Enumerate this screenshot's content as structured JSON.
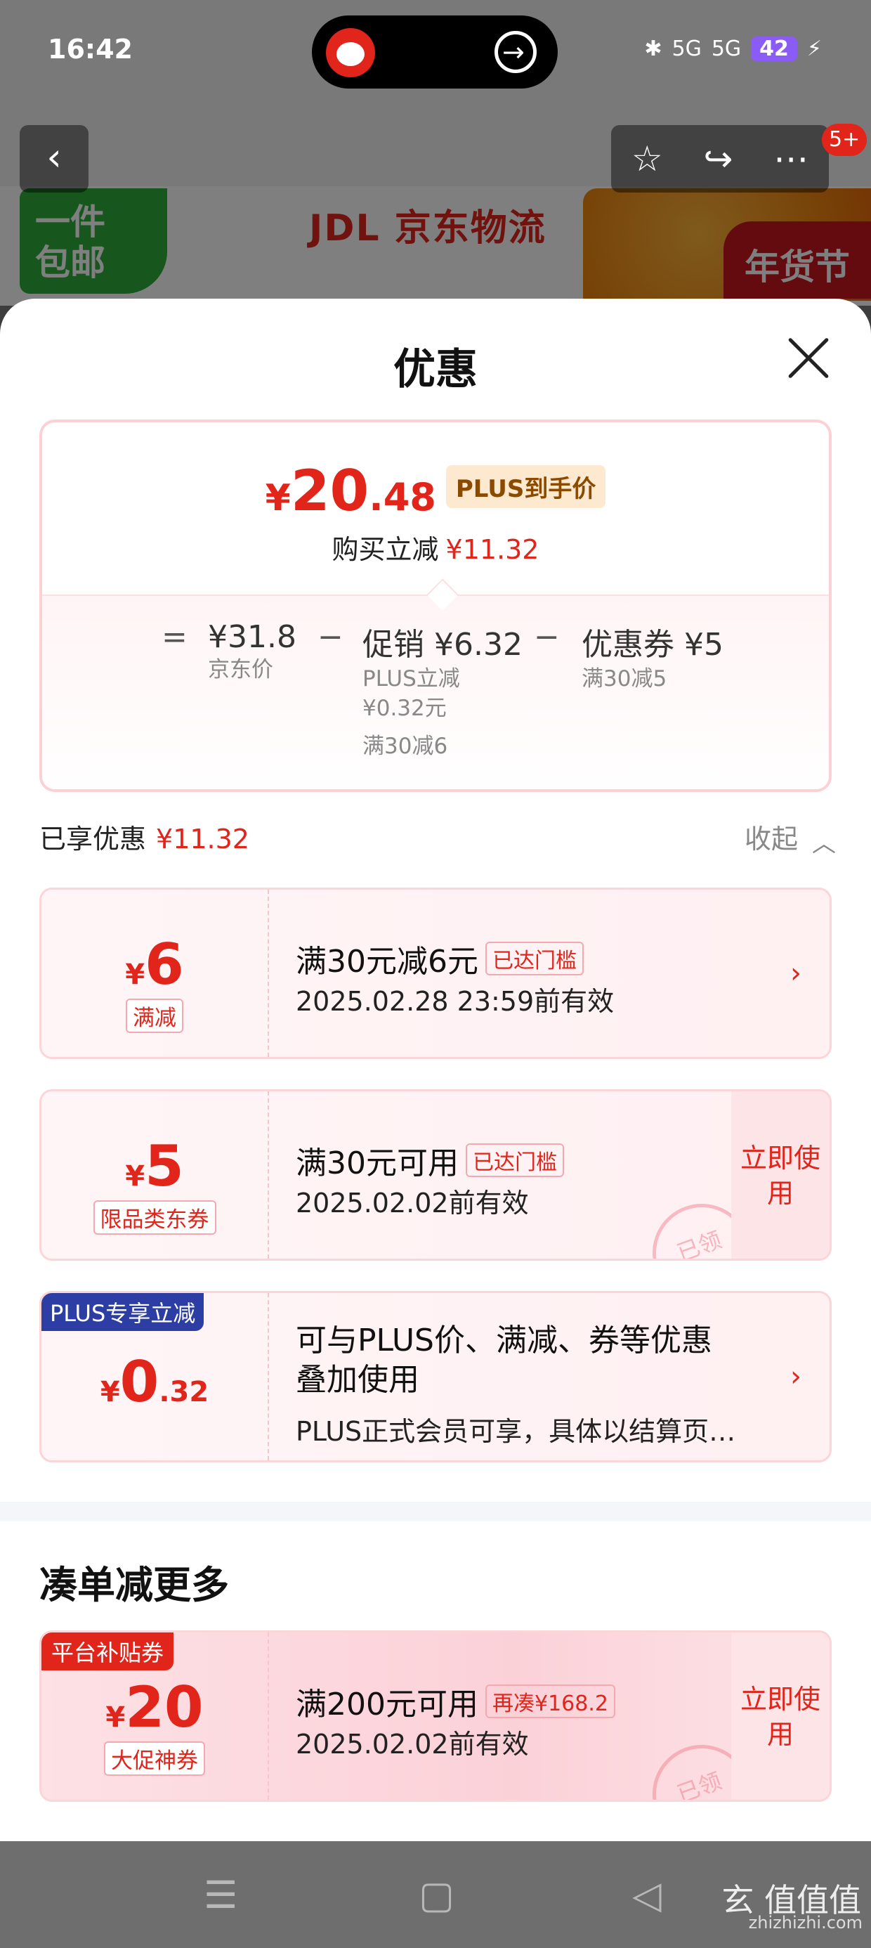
{
  "status_bar": {
    "time": "16:42",
    "signal1": "5G",
    "signal2": "5G",
    "battery": "42"
  },
  "background": {
    "banner_left_lines": [
      "一件",
      "包邮"
    ],
    "banner_brand": "JDL 京东物流",
    "banner_right": "年货节",
    "nav_badge": "5+"
  },
  "sheet": {
    "title": "优惠",
    "summary": {
      "price_yen": "¥",
      "price_int": "20",
      "price_dec": ".48",
      "plus_tag": "PLUS到手价",
      "save_label": "购买立减",
      "save_amount": "¥11.32",
      "eq": "=",
      "minus": "−",
      "jd_price": "¥31.8",
      "jd_price_label": "京东价",
      "promo": "促销 ¥6.32",
      "promo_sub1": "PLUS立减",
      "promo_sub2": "¥0.32元",
      "promo_sub3": "满30减6",
      "coupon": "优惠券 ¥5",
      "coupon_sub": "满30减5"
    },
    "enjoyed_label": "已享优惠",
    "enjoyed_amount": "¥11.32",
    "collapse_label": "收起",
    "coupons": [
      {
        "yen": "¥",
        "num": "6",
        "dec": "",
        "type": "满减",
        "title": "满30元减6元",
        "badge": "已达门槛",
        "date": "2025.02.28 23:59前有效"
      },
      {
        "yen": "¥",
        "num": "5",
        "dec": "",
        "type": "限品类东券",
        "title": "满30元可用",
        "badge": "已达门槛",
        "date": "2025.02.02前有效",
        "action": "立即使用",
        "stamp": "已领"
      },
      {
        "corner": "PLUS专享立减",
        "yen": "¥",
        "num": "0",
        "dec": ".32",
        "title_line1": "可与PLUS价、满减、券等优惠",
        "title_line2": "叠加使用",
        "sub": "PLUS正式会员可享，具体以结算页为准"
      }
    ],
    "more_title": "凑单减更多",
    "more_coupon": {
      "corner": "平台补贴券",
      "yen": "¥",
      "num": "20",
      "type": "大促神券",
      "title": "满200元可用",
      "badge": "再凑¥168.2",
      "date": "2025.02.02前有效",
      "action": "立即使用",
      "stamp": "已领"
    }
  },
  "watermark": {
    "big": "玄 值值值",
    "small": "zhizhizhi.com"
  }
}
